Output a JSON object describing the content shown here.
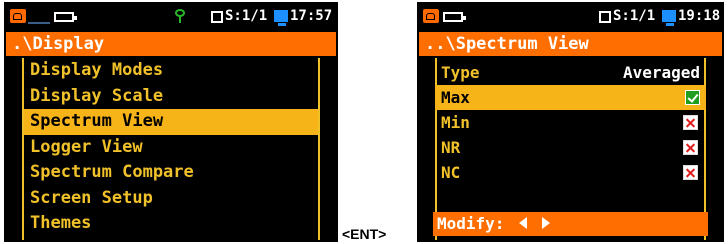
{
  "left_screen": {
    "status": {
      "memory_text": "S:1/1",
      "time": "17:57"
    },
    "title": ".\\Display",
    "menu_items": [
      {
        "label": "Display Modes"
      },
      {
        "label": "Display Scale"
      },
      {
        "label": "Spectrum View",
        "selected": true
      },
      {
        "label": "Logger View"
      },
      {
        "label": "Spectrum Compare"
      },
      {
        "label": "Screen Setup"
      },
      {
        "label": "Themes"
      }
    ]
  },
  "right_screen": {
    "status": {
      "memory_text": "S:1/1",
      "time": "19:18"
    },
    "title": "..\\Spectrum View",
    "type_row": {
      "label": "Type",
      "value": "Averaged"
    },
    "options": [
      {
        "label": "Max",
        "checked": true,
        "selected": true
      },
      {
        "label": "Min",
        "checked": false
      },
      {
        "label": "NR",
        "checked": false
      },
      {
        "label": "NC",
        "checked": false
      }
    ],
    "footer": "Modify:"
  },
  "key_label": "<ENT>",
  "colors": {
    "title_bar": "#ff6e00",
    "menu_text": "#f1c12a",
    "selection": "#f6b419",
    "screen_bg": "#000000"
  }
}
